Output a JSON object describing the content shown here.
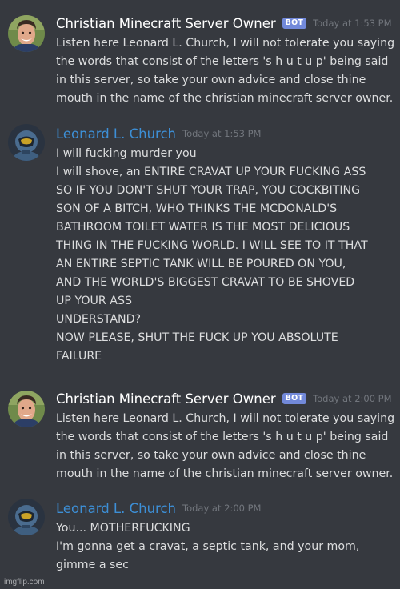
{
  "messages": [
    {
      "author": "Christian Minecraft Server Owner",
      "bot_tag": "BOT",
      "time": "Today at 1:53 PM",
      "lines": [
        "Listen here Leonard L. Church, I will not tolerate you saying",
        "the words that consist of the letters 's h u t  u p' being said",
        "in this server, so take your own advice and close thine",
        "mouth in the name of the christian minecraft server owner."
      ]
    },
    {
      "author": "Leonard L. Church",
      "time": "Today at 1:53 PM",
      "lines": [
        "I will fucking murder you",
        "I will shove, an ENTIRE CRAVAT UP YOUR FUCKING ASS",
        "SO IF YOU DON'T SHUT YOUR TRAP, YOU COCKBITING",
        "SON OF A BITCH, WHO THINKS THE MCDONALD'S",
        "BATHROOM TOILET WATER IS THE MOST DELICIOUS",
        "THING IN THE FUCKING WORLD. I WILL SEE TO IT THAT",
        "AN ENTIRE SEPTIC TANK WILL BE POURED ON YOU,",
        "AND THE WORLD'S BIGGEST CRAVAT TO BE SHOVED",
        "UP YOUR ASS",
        "UNDERSTAND?",
        "NOW PLEASE, SHUT THE FUCK UP YOU ABSOLUTE",
        "FAILURE"
      ]
    },
    {
      "author": "Christian Minecraft Server Owner",
      "bot_tag": "BOT",
      "time": "Today at 2:00 PM",
      "lines": [
        "Listen here Leonard L. Church, I will not tolerate you saying",
        "the words that consist of the letters 's h u t  u p' being said",
        "in this server, so take your own advice and close thine",
        "mouth in the name of the christian minecraft server owner."
      ]
    },
    {
      "author": "Leonard L. Church",
      "time": "Today at 2:00 PM",
      "lines": [
        "You... MOTHERFUCKING",
        "I'm gonna get a cravat, a septic tank, and your mom,",
        "gimme a sec"
      ]
    }
  ],
  "watermark": "imgflip.com",
  "colors": {
    "background": "#36393f",
    "owner_name": "#ffffff",
    "church_name": "#3d8fd6",
    "bot_tag": "#7289da",
    "timestamp": "#72767d",
    "message_text": "#dcddde"
  },
  "icons": {
    "owner_avatar": "smiling-man-avatar-icon",
    "church_avatar": "armored-helmet-avatar-icon"
  }
}
